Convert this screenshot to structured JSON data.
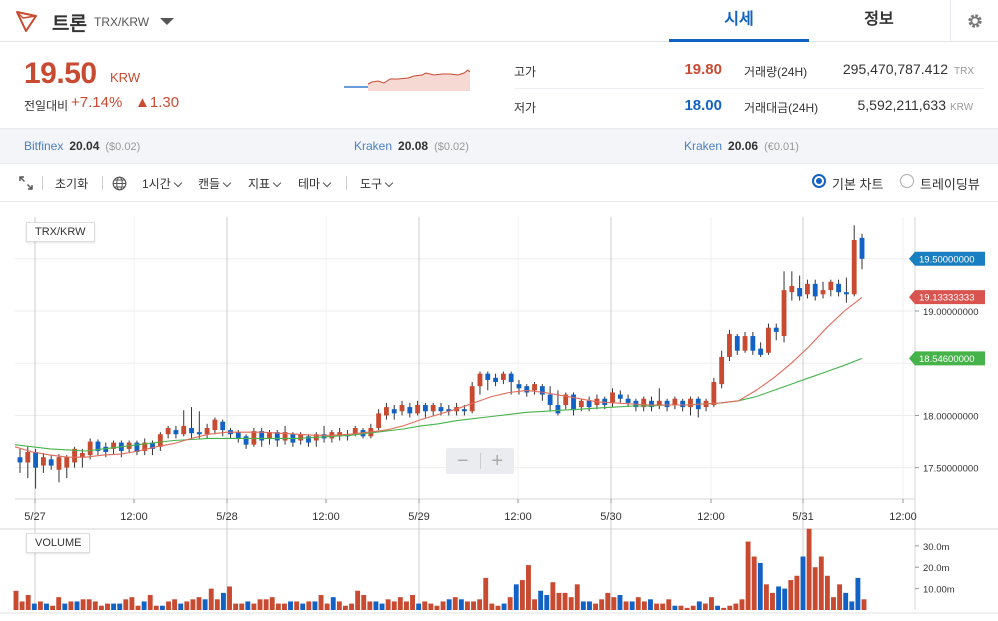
{
  "header": {
    "coin_name": "트론",
    "pair": "TRX/KRW",
    "tabs": [
      "시세",
      "정보"
    ]
  },
  "ticker": {
    "price": "19.50",
    "unit": "KRW",
    "change_label": "전일대비",
    "change_pct": "+7.14%",
    "change_abs": "▲1.30",
    "high_label": "고가",
    "high": "19.80",
    "low_label": "저가",
    "low": "18.00",
    "volume_label": "거래량(24H)",
    "volume": "295,470,787.412",
    "volume_unit": "TRX",
    "value_label": "거래대금(24H)",
    "value": "5,592,211,633",
    "value_unit": "KRW"
  },
  "exchanges": [
    {
      "name": "Bitfinex",
      "price": "20.04",
      "diff": "($0.02)"
    },
    {
      "name": "Kraken",
      "price": "20.08",
      "diff": "($0.02)"
    },
    {
      "name": "Kraken",
      "price": "20.06",
      "diff": "(€0.01)"
    }
  ],
  "toolbar": {
    "reset": "초기화",
    "interval": "1시간",
    "candle": "캔들",
    "indicator": "지표",
    "theme": "테마",
    "tools": "도구",
    "basic_chart": "기본 차트",
    "tradingview": "트레이딩뷰"
  },
  "colors": {
    "up": "#c84a31",
    "down": "#1261c4",
    "ma_fast": "#e06b5a",
    "ma_slow": "#46b34a",
    "accent": "#1261c4"
  },
  "chart_data": {
    "type": "candlestick",
    "title": "TRX/KRW",
    "x_tick_labels": [
      "5/27",
      "12:00",
      "5/28",
      "12:00",
      "5/29",
      "12:00",
      "5/30",
      "12:00",
      "5/31",
      "12:00"
    ],
    "y_tick_labels": [
      "19.00000000",
      "18.00000000",
      "17.50000000"
    ],
    "price_markers": [
      "19.50000000",
      "19.13333333",
      "18.54600000"
    ],
    "y_range": [
      17.2,
      19.9
    ],
    "candles": [
      {
        "o": 17.6,
        "c": 17.55,
        "h": 17.68,
        "l": 17.45
      },
      {
        "o": 17.55,
        "c": 17.65,
        "h": 17.7,
        "l": 17.4
      },
      {
        "o": 17.65,
        "c": 17.5,
        "h": 17.68,
        "l": 17.3
      },
      {
        "o": 17.52,
        "c": 17.6,
        "h": 17.64,
        "l": 17.45
      },
      {
        "o": 17.58,
        "c": 17.52,
        "h": 17.62,
        "l": 17.48
      },
      {
        "o": 17.48,
        "c": 17.6,
        "h": 17.63,
        "l": 17.36
      },
      {
        "o": 17.5,
        "c": 17.6,
        "h": 17.62,
        "l": 17.4
      },
      {
        "o": 17.55,
        "c": 17.68,
        "h": 17.7,
        "l": 17.5
      },
      {
        "o": 17.6,
        "c": 17.64,
        "h": 17.68,
        "l": 17.5
      },
      {
        "o": 17.62,
        "c": 17.75,
        "h": 17.78,
        "l": 17.58
      },
      {
        "o": 17.75,
        "c": 17.66,
        "h": 17.77,
        "l": 17.62
      },
      {
        "o": 17.7,
        "c": 17.65,
        "h": 17.74,
        "l": 17.6
      },
      {
        "o": 17.68,
        "c": 17.74,
        "h": 17.76,
        "l": 17.63
      },
      {
        "o": 17.74,
        "c": 17.66,
        "h": 17.76,
        "l": 17.6
      },
      {
        "o": 17.68,
        "c": 17.74,
        "h": 17.76,
        "l": 17.64
      },
      {
        "o": 17.74,
        "c": 17.65,
        "h": 17.76,
        "l": 17.62
      },
      {
        "o": 17.66,
        "c": 17.74,
        "h": 17.78,
        "l": 17.62
      },
      {
        "o": 17.74,
        "c": 17.68,
        "h": 17.76,
        "l": 17.62
      },
      {
        "o": 17.7,
        "c": 17.82,
        "h": 17.84,
        "l": 17.66
      },
      {
        "o": 17.82,
        "c": 17.88,
        "h": 17.9,
        "l": 17.78
      },
      {
        "o": 17.86,
        "c": 17.82,
        "h": 17.9,
        "l": 17.78
      },
      {
        "o": 17.82,
        "c": 17.9,
        "h": 18.05,
        "l": 17.8
      },
      {
        "o": 17.88,
        "c": 17.83,
        "h": 18.08,
        "l": 17.78
      },
      {
        "o": 17.84,
        "c": 17.82,
        "h": 18.04,
        "l": 17.78
      },
      {
        "o": 17.82,
        "c": 17.88,
        "h": 17.92,
        "l": 17.78
      },
      {
        "o": 17.86,
        "c": 17.96,
        "h": 17.98,
        "l": 17.82
      },
      {
        "o": 17.94,
        "c": 17.86,
        "h": 17.96,
        "l": 17.8
      },
      {
        "o": 17.86,
        "c": 17.82,
        "h": 17.88,
        "l": 17.78
      },
      {
        "o": 17.84,
        "c": 17.78,
        "h": 17.86,
        "l": 17.74
      },
      {
        "o": 17.8,
        "c": 17.72,
        "h": 17.82,
        "l": 17.68
      },
      {
        "o": 17.72,
        "c": 17.85,
        "h": 17.88,
        "l": 17.7
      },
      {
        "o": 17.85,
        "c": 17.76,
        "h": 17.88,
        "l": 17.7
      },
      {
        "o": 17.78,
        "c": 17.84,
        "h": 17.86,
        "l": 17.72
      },
      {
        "o": 17.84,
        "c": 17.76,
        "h": 17.86,
        "l": 17.7
      },
      {
        "o": 17.76,
        "c": 17.84,
        "h": 17.9,
        "l": 17.72
      },
      {
        "o": 17.82,
        "c": 17.74,
        "h": 17.84,
        "l": 17.7
      },
      {
        "o": 17.76,
        "c": 17.82,
        "h": 17.84,
        "l": 17.72
      },
      {
        "o": 17.8,
        "c": 17.74,
        "h": 17.82,
        "l": 17.7
      },
      {
        "o": 17.76,
        "c": 17.82,
        "h": 17.84,
        "l": 17.7
      },
      {
        "o": 17.82,
        "c": 17.78,
        "h": 17.9,
        "l": 17.74
      },
      {
        "o": 17.78,
        "c": 17.84,
        "h": 17.86,
        "l": 17.74
      },
      {
        "o": 17.8,
        "c": 17.84,
        "h": 17.88,
        "l": 17.76
      },
      {
        "o": 17.82,
        "c": 17.8,
        "h": 17.86,
        "l": 17.76
      },
      {
        "o": 17.82,
        "c": 17.88,
        "h": 17.9,
        "l": 17.8
      },
      {
        "o": 17.86,
        "c": 17.8,
        "h": 17.88,
        "l": 17.78
      },
      {
        "o": 17.8,
        "c": 17.88,
        "h": 17.92,
        "l": 17.78
      },
      {
        "o": 17.88,
        "c": 18.02,
        "h": 18.06,
        "l": 17.86
      },
      {
        "o": 18.0,
        "c": 18.08,
        "h": 18.12,
        "l": 17.96
      },
      {
        "o": 18.06,
        "c": 18.02,
        "h": 18.1,
        "l": 17.96
      },
      {
        "o": 18.04,
        "c": 18.1,
        "h": 18.14,
        "l": 18.0
      },
      {
        "o": 18.08,
        "c": 18.02,
        "h": 18.12,
        "l": 17.98
      },
      {
        "o": 18.02,
        "c": 18.1,
        "h": 18.14,
        "l": 18.0
      },
      {
        "o": 18.1,
        "c": 18.04,
        "h": 18.12,
        "l": 17.98
      },
      {
        "o": 18.04,
        "c": 18.1,
        "h": 18.12,
        "l": 18.0
      },
      {
        "o": 18.08,
        "c": 18.04,
        "h": 18.12,
        "l": 18.0
      },
      {
        "o": 18.06,
        "c": 18.04,
        "h": 18.1,
        "l": 18.0
      },
      {
        "o": 18.04,
        "c": 18.08,
        "h": 18.12,
        "l": 18.0
      },
      {
        "o": 18.06,
        "c": 18.04,
        "h": 18.1,
        "l": 18.0
      },
      {
        "o": 18.04,
        "c": 18.28,
        "h": 18.32,
        "l": 18.02
      },
      {
        "o": 18.28,
        "c": 18.4,
        "h": 18.42,
        "l": 18.2
      },
      {
        "o": 18.4,
        "c": 18.34,
        "h": 18.42,
        "l": 18.24
      },
      {
        "o": 18.36,
        "c": 18.32,
        "h": 18.4,
        "l": 18.28
      },
      {
        "o": 18.34,
        "c": 18.4,
        "h": 18.42,
        "l": 18.3
      },
      {
        "o": 18.4,
        "c": 18.32,
        "h": 18.42,
        "l": 18.2
      },
      {
        "o": 18.3,
        "c": 18.26,
        "h": 18.34,
        "l": 18.2
      },
      {
        "o": 18.28,
        "c": 18.22,
        "h": 18.3,
        "l": 18.18
      },
      {
        "o": 18.24,
        "c": 18.3,
        "h": 18.32,
        "l": 18.2
      },
      {
        "o": 18.28,
        "c": 18.2,
        "h": 18.3,
        "l": 18.14
      },
      {
        "o": 18.2,
        "c": 18.1,
        "h": 18.28,
        "l": 18.04
      },
      {
        "o": 18.1,
        "c": 18.02,
        "h": 18.24,
        "l": 18.0
      },
      {
        "o": 18.1,
        "c": 18.2,
        "h": 18.22,
        "l": 18.06
      },
      {
        "o": 18.2,
        "c": 18.05,
        "h": 18.22,
        "l": 18.0
      },
      {
        "o": 18.08,
        "c": 18.14,
        "h": 18.16,
        "l": 18.04
      },
      {
        "o": 18.14,
        "c": 18.08,
        "h": 18.18,
        "l": 18.04
      },
      {
        "o": 18.1,
        "c": 18.16,
        "h": 18.2,
        "l": 18.06
      },
      {
        "o": 18.16,
        "c": 18.1,
        "h": 18.18,
        "l": 18.06
      },
      {
        "o": 18.12,
        "c": 18.22,
        "h": 18.26,
        "l": 18.08
      },
      {
        "o": 18.2,
        "c": 18.16,
        "h": 18.24,
        "l": 18.12
      },
      {
        "o": 18.16,
        "c": 18.12,
        "h": 18.2,
        "l": 18.08
      },
      {
        "o": 18.14,
        "c": 18.08,
        "h": 18.16,
        "l": 18.04
      },
      {
        "o": 18.08,
        "c": 18.16,
        "h": 18.18,
        "l": 18.04
      },
      {
        "o": 18.14,
        "c": 18.08,
        "h": 18.18,
        "l": 18.04
      },
      {
        "o": 18.1,
        "c": 18.14,
        "h": 18.26,
        "l": 18.06
      },
      {
        "o": 18.14,
        "c": 18.08,
        "h": 18.16,
        "l": 18.04
      },
      {
        "o": 18.1,
        "c": 18.16,
        "h": 18.18,
        "l": 18.06
      },
      {
        "o": 18.14,
        "c": 18.08,
        "h": 18.16,
        "l": 18.04
      },
      {
        "o": 18.08,
        "c": 18.16,
        "h": 18.18,
        "l": 18.0
      },
      {
        "o": 18.16,
        "c": 18.06,
        "h": 18.18,
        "l": 17.98
      },
      {
        "o": 18.08,
        "c": 18.14,
        "h": 18.16,
        "l": 18.04
      },
      {
        "o": 18.1,
        "c": 18.32,
        "h": 18.36,
        "l": 18.08
      },
      {
        "o": 18.3,
        "c": 18.56,
        "h": 18.62,
        "l": 18.26
      },
      {
        "o": 18.56,
        "c": 18.78,
        "h": 18.82,
        "l": 18.52
      },
      {
        "o": 18.76,
        "c": 18.62,
        "h": 18.78,
        "l": 18.58
      },
      {
        "o": 18.62,
        "c": 18.76,
        "h": 18.8,
        "l": 18.6
      },
      {
        "o": 18.76,
        "c": 18.62,
        "h": 18.8,
        "l": 18.58
      },
      {
        "o": 18.64,
        "c": 18.58,
        "h": 18.7,
        "l": 18.56
      },
      {
        "o": 18.6,
        "c": 18.84,
        "h": 18.88,
        "l": 18.58
      },
      {
        "o": 18.84,
        "c": 18.8,
        "h": 18.88,
        "l": 18.72
      },
      {
        "o": 18.76,
        "c": 19.2,
        "h": 19.38,
        "l": 18.7
      },
      {
        "o": 19.18,
        "c": 19.24,
        "h": 19.38,
        "l": 19.1
      },
      {
        "o": 19.22,
        "c": 19.14,
        "h": 19.34,
        "l": 19.1
      },
      {
        "o": 19.16,
        "c": 19.26,
        "h": 19.3,
        "l": 19.12
      },
      {
        "o": 19.26,
        "c": 19.14,
        "h": 19.3,
        "l": 19.1
      },
      {
        "o": 19.16,
        "c": 19.2,
        "h": 19.28,
        "l": 19.12
      },
      {
        "o": 19.2,
        "c": 19.28,
        "h": 19.3,
        "l": 19.14
      },
      {
        "o": 19.26,
        "c": 19.18,
        "h": 19.3,
        "l": 19.14
      },
      {
        "o": 19.18,
        "c": 19.16,
        "h": 19.32,
        "l": 19.08
      },
      {
        "o": 19.16,
        "c": 19.68,
        "h": 19.82,
        "l": 19.14
      },
      {
        "o": 19.7,
        "c": 19.5,
        "h": 19.74,
        "l": 19.4
      }
    ],
    "ma_fast": [
      17.7,
      17.65,
      17.62,
      17.6,
      17.6,
      17.62,
      17.63,
      17.66,
      17.7,
      17.73,
      17.78,
      17.82,
      17.84,
      17.84,
      17.84,
      17.83,
      17.82,
      17.81,
      17.81,
      17.82,
      17.84,
      17.86,
      17.9,
      17.96,
      18.01,
      18.06,
      18.12,
      18.18,
      18.22,
      18.24,
      18.22,
      18.19,
      18.16,
      18.13,
      18.12,
      18.11,
      18.1,
      18.1,
      18.1,
      18.11,
      18.12,
      18.14,
      18.24,
      18.36,
      18.5,
      18.66,
      18.84,
      19.0,
      19.13
    ],
    "ma_slow": [
      17.72,
      17.7,
      17.68,
      17.67,
      17.66,
      17.68,
      17.7,
      17.72,
      17.74,
      17.76,
      17.77,
      17.78,
      17.78,
      17.78,
      17.78,
      17.78,
      17.78,
      17.79,
      17.8,
      17.81,
      17.83,
      17.85,
      17.87,
      17.9,
      17.92,
      17.95,
      17.97,
      17.99,
      18.01,
      18.03,
      18.04,
      18.05,
      18.06,
      18.07,
      18.08,
      18.09,
      18.09,
      18.1,
      18.1,
      18.11,
      18.12,
      18.14,
      18.18,
      18.24,
      18.3,
      18.36,
      18.42,
      18.48,
      18.546
    ],
    "volume": {
      "y_tick_labels": [
        "30.0m",
        "20.0m",
        "10.00m"
      ],
      "y_range": [
        0,
        36
      ],
      "values": [
        9,
        4,
        7,
        3,
        4,
        3,
        2,
        6,
        3,
        4,
        4,
        5,
        5,
        4,
        2,
        3,
        3,
        3,
        5,
        6,
        2,
        4,
        7,
        2,
        2,
        4,
        5,
        3,
        4,
        5,
        6,
        5,
        10,
        5,
        8,
        11,
        3,
        3,
        4,
        3,
        5,
        5,
        6,
        3,
        3,
        4,
        4,
        3,
        4,
        4,
        7,
        3,
        6,
        4,
        2,
        3,
        9,
        7,
        4,
        4,
        3,
        5,
        4,
        6,
        4,
        7,
        3,
        4,
        3,
        2,
        4,
        5,
        6,
        5,
        4,
        4,
        5,
        15,
        3,
        2,
        3,
        6,
        12,
        14,
        21,
        5,
        9,
        7,
        13,
        8,
        8,
        6,
        12,
        4,
        4,
        3,
        5,
        8,
        6,
        7,
        4,
        4,
        6,
        4,
        5,
        3,
        3,
        5,
        2,
        2,
        1,
        2,
        4,
        3,
        6,
        2,
        1,
        2,
        3,
        5,
        32,
        25,
        22,
        12,
        8,
        11,
        10,
        14,
        16,
        25,
        38,
        20,
        25,
        16,
        6,
        12,
        8,
        4,
        15,
        5
      ]
    }
  }
}
